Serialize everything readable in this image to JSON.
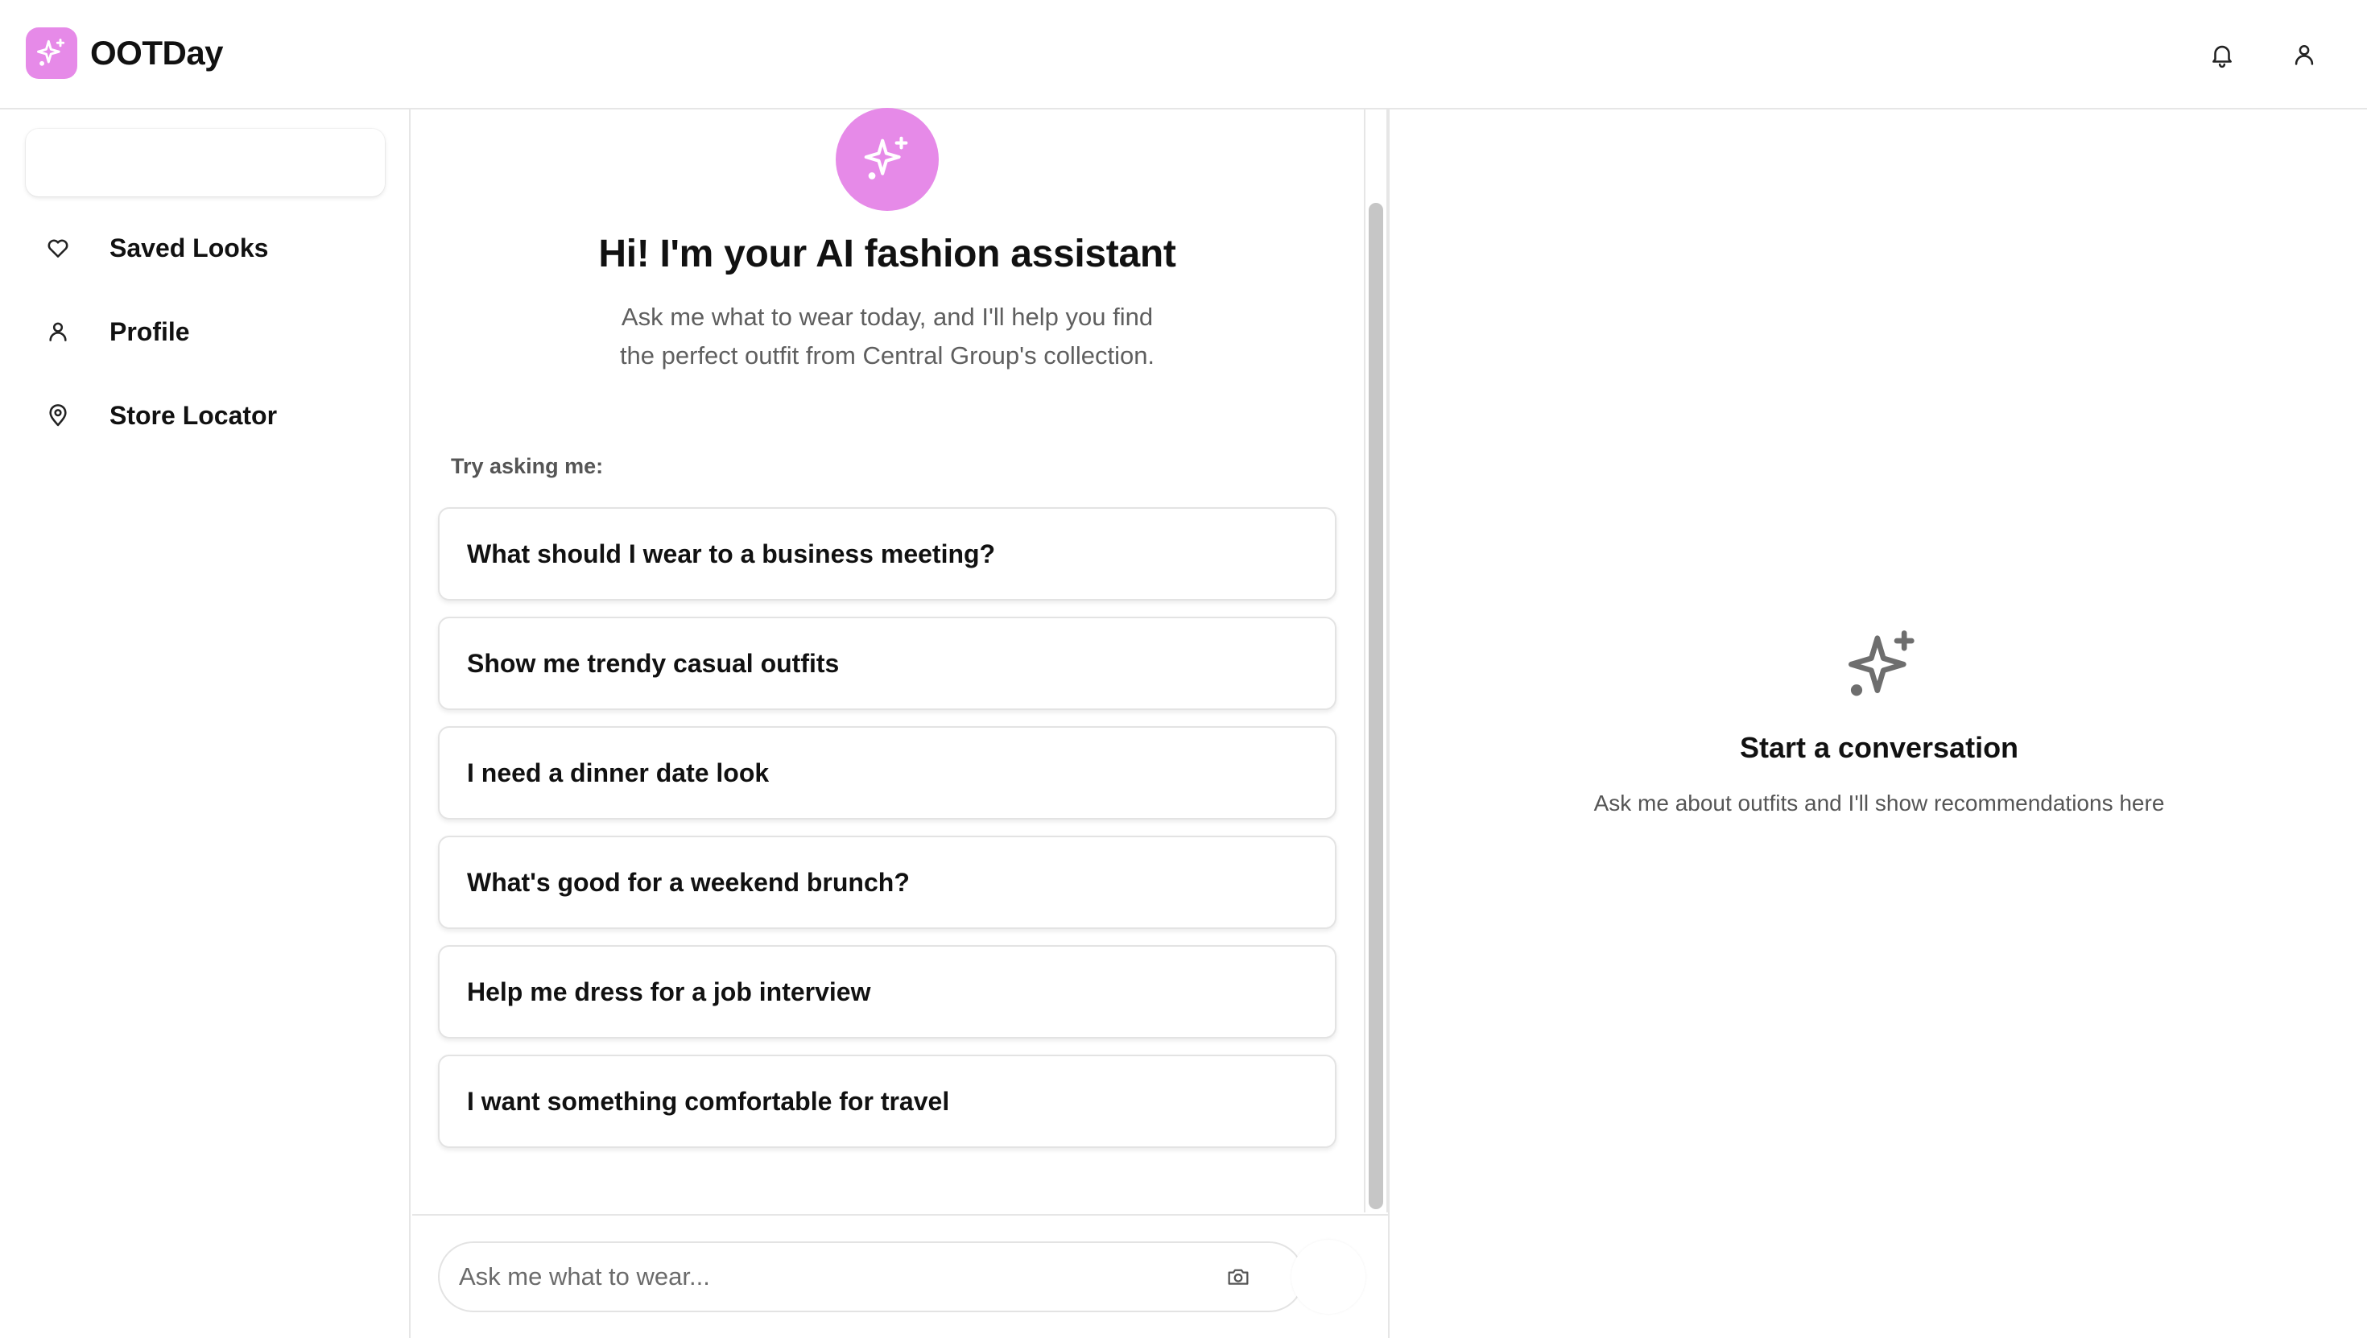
{
  "app": {
    "title": "OOTDay",
    "accent_color": "#e68ae8",
    "logo_icon": "sparkles-icon",
    "header_icons": [
      "bell-icon",
      "user-icon"
    ]
  },
  "sidebar": {
    "search_placeholder": "",
    "items": [
      {
        "label": "Saved Looks",
        "icon": "heart-icon"
      },
      {
        "label": "Profile",
        "icon": "user-icon"
      },
      {
        "label": "Store Locator",
        "icon": "map-pin-icon"
      }
    ]
  },
  "chat": {
    "hero_icon": "sparkles-icon",
    "title": "Hi! I'm your AI fashion assistant",
    "subtitle_line1": "Ask me what to wear today, and I'll help you find",
    "subtitle_line2": "the perfect outfit from Central Group's collection.",
    "try_label": "Try asking me:",
    "suggestions": [
      "What should I wear to a business meeting?",
      "Show me trendy casual outfits",
      "I need a dinner date look",
      "What's good for a weekend brunch?",
      "Help me dress for a job interview",
      "I want something comfortable for travel"
    ],
    "input_placeholder": "Ask me what to wear...",
    "input_value": "",
    "camera_icon": "camera-icon"
  },
  "results": {
    "empty_icon": "sparkles-icon",
    "empty_title": "Start a conversation",
    "empty_subtitle": "Ask me about outfits and I'll show recommendations here"
  }
}
